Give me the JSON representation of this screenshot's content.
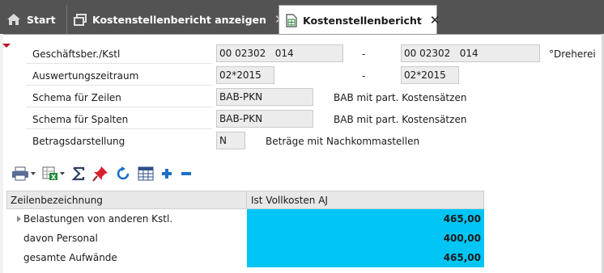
{
  "tabs": [
    {
      "label": "Start",
      "icon": "home-icon",
      "closable": false
    },
    {
      "label": "Kostenstellenbericht anzeigen",
      "icon": "window-icon",
      "closable": true,
      "close": "✕"
    },
    {
      "label": "Kostenstellenbericht",
      "icon": "report-icon",
      "closable": true,
      "close": "✕",
      "active": true
    }
  ],
  "form": {
    "rows": [
      {
        "label": "Geschäftsber./Kstl",
        "from": "00 02302   014",
        "dash": "-",
        "to": "00 02302   014",
        "desc": "°Dreherei"
      },
      {
        "label": "Auswertungszeitraum",
        "from": "02*2015",
        "dash": "-",
        "to": "02*2015"
      },
      {
        "label": "Schema für Zeilen",
        "value": "BAB-PKN",
        "desc": "BAB mit part. Kostensätzen"
      },
      {
        "label": "Schema für Spalten",
        "value": "BAB-PKN",
        "desc": "BAB mit part. Kostensätzen"
      },
      {
        "label": "Betragsdarstellung",
        "value": "N",
        "desc": "Beträge mit Nachkommastellen"
      }
    ]
  },
  "toolbar": {
    "items": [
      "print-icon",
      "excel-export-icon",
      "sum-icon",
      "pin-icon",
      "refresh-icon",
      "table-icon",
      "plus-icon",
      "minus-icon"
    ]
  },
  "grid": {
    "columns": [
      "Zeilenbezeichnung",
      "Ist Vollkosten AJ"
    ],
    "rows": [
      {
        "name": "Belastungen von anderen Kstl.",
        "value": "465,00",
        "expandable": true
      },
      {
        "name": "davon Personal",
        "value": "400,00",
        "expandable": false
      },
      {
        "name": "gesamte Aufwände",
        "value": "465,00",
        "expandable": false
      }
    ]
  },
  "colors": {
    "tabbar": "#535353",
    "highlight": "#00c5f5",
    "marker": "#c0102a",
    "accent_blue": "#1a6fc9"
  }
}
